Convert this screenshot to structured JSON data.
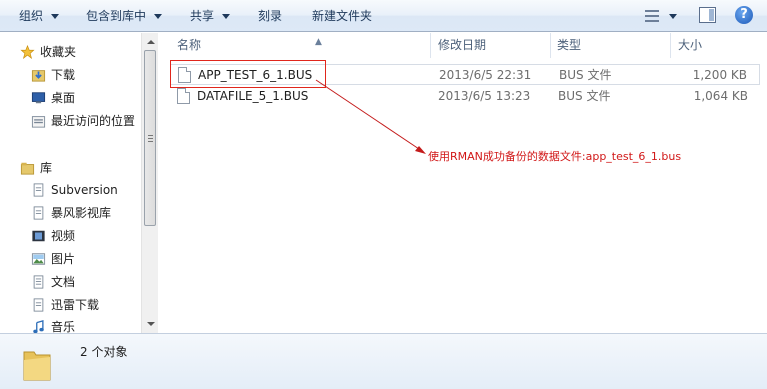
{
  "toolbar": {
    "organize": "组织",
    "include_in_library": "包含到库中",
    "share": "共享",
    "burn": "刻录",
    "new_folder": "新建文件夹",
    "help": "?"
  },
  "nav": {
    "favorites": "收藏夹",
    "downloads": "下载",
    "desktop": "桌面",
    "recent_places": "最近访问的位置",
    "libraries": "库",
    "subversion": "Subversion",
    "storm_video": "暴风影视库",
    "videos": "视频",
    "pictures": "图片",
    "documents": "文档",
    "thunder_downloads": "迅雷下载",
    "music": "音乐"
  },
  "columns": {
    "name": "名称",
    "date_modified": "修改日期",
    "type": "类型",
    "size": "大小"
  },
  "files": [
    {
      "name": "APP_TEST_6_1.BUS",
      "date": "2013/6/5 22:31",
      "type": "BUS 文件",
      "size": "1,200 KB"
    },
    {
      "name": "DATAFILE_5_1.BUS",
      "date": "2013/6/5 13:23",
      "type": "BUS 文件",
      "size": "1,064 KB"
    }
  ],
  "annotation": "使用RMAN成功备份的数据文件:app_test_6_1.bus",
  "status": {
    "count": "2 个对象"
  },
  "colors": {
    "accent_red": "#d11717",
    "toolbar_text": "#1e395b"
  }
}
